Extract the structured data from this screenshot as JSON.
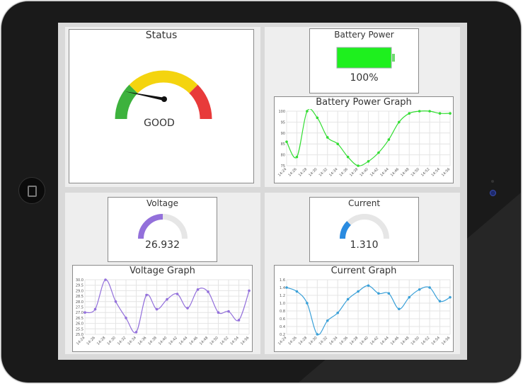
{
  "status": {
    "title": "Status",
    "value": "GOOD",
    "needle_fraction": 0.05,
    "colors": {
      "green": "#3db23d",
      "yellow": "#f4d40f",
      "red": "#e83a3a"
    }
  },
  "battery": {
    "title": "Battery Power",
    "value": "100%",
    "level_fraction": 1.0,
    "color": "#1ef01e"
  },
  "voltage": {
    "title": "Voltage",
    "value": "26.932",
    "gauge_fraction": 0.5,
    "color": "#9370db"
  },
  "current": {
    "title": "Current",
    "value": "1.310",
    "gauge_fraction": 0.25,
    "color": "#2a8be0"
  },
  "chart_data": [
    {
      "type": "line",
      "title": "Battery Power Graph",
      "color": "#33dd33",
      "x": [
        "14:24",
        "14:26",
        "14:28",
        "14:30",
        "14:32",
        "14:34",
        "14:36",
        "14:38",
        "14:40",
        "14:42",
        "14:44",
        "14:46",
        "14:48",
        "14:50",
        "14:52",
        "14:54",
        "14:56"
      ],
      "yticks": [
        "100",
        "95",
        "90",
        "85",
        "80",
        "75"
      ],
      "ylim": [
        75,
        100
      ],
      "values": [
        86,
        79,
        100,
        97,
        88,
        85,
        79,
        75,
        77,
        81,
        87,
        95,
        99,
        100,
        100,
        99,
        99
      ],
      "grid": true
    },
    {
      "type": "line",
      "title": "Voltage Graph",
      "color": "#9370db",
      "x": [
        "14:24",
        "14:26",
        "14:28",
        "14:30",
        "14:32",
        "14:34",
        "14:36",
        "14:38",
        "14:40",
        "14:42",
        "14:44",
        "14:46",
        "14:48",
        "14:50",
        "14:52",
        "14:54",
        "14:56"
      ],
      "yticks": [
        "30.0",
        "29.5",
        "29.0",
        "28.5",
        "28.0",
        "27.5",
        "27.0",
        "26.5",
        "26.0",
        "25.5",
        "25.0"
      ],
      "ylim": [
        25,
        30
      ],
      "values": [
        27.0,
        27.3,
        30.0,
        28.0,
        26.5,
        25.2,
        28.6,
        27.3,
        28.2,
        28.7,
        27.4,
        29.1,
        28.9,
        27.0,
        27.1,
        26.3,
        29.0
      ],
      "grid": true
    },
    {
      "type": "line",
      "title": "Current Graph",
      "color": "#3aa0d8",
      "x": [
        "14:24",
        "14:26",
        "14:28",
        "14:30",
        "14:32",
        "14:34",
        "14:36",
        "14:38",
        "14:40",
        "14:42",
        "14:44",
        "14:46",
        "14:48",
        "14:50",
        "14:52",
        "14:54",
        "14:56"
      ],
      "yticks": [
        "1.6",
        "1.4",
        "1.2",
        "1.0",
        "0.8",
        "0.6",
        "0.4",
        "0.2"
      ],
      "ylim": [
        0.2,
        1.6
      ],
      "values": [
        1.4,
        1.3,
        1.0,
        0.2,
        0.55,
        0.75,
        1.1,
        1.3,
        1.45,
        1.25,
        1.25,
        0.85,
        1.15,
        1.35,
        1.4,
        1.05,
        1.15
      ],
      "grid": true
    }
  ]
}
